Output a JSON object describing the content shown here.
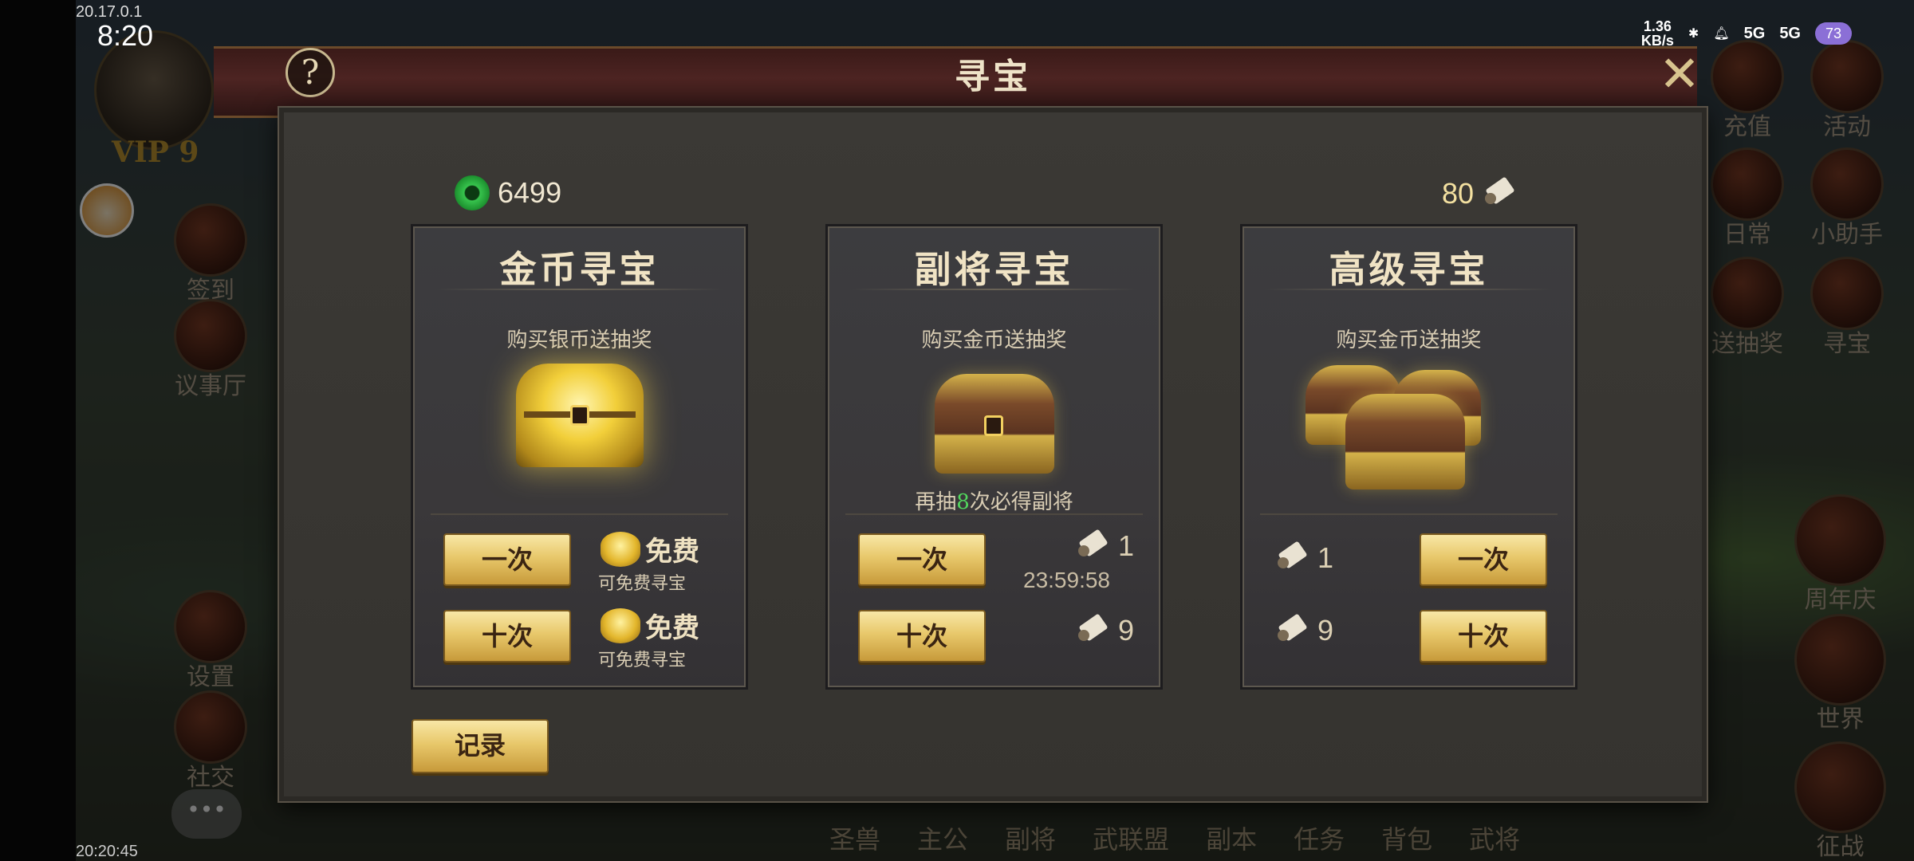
{
  "status_bar": {
    "version": "20.17.0.1",
    "time": "8:20",
    "net_speed_value": "1.36",
    "net_speed_unit": "KB/s",
    "signal_1": "5G",
    "signal_2": "5G",
    "battery": "73"
  },
  "bottom_clock": "20:20:45",
  "player": {
    "vip": "VIP 9"
  },
  "side_left": [
    "签到",
    "议事厅",
    "设置",
    "社交"
  ],
  "side_right_top": [
    "充值",
    "活动",
    "日常",
    "小助手",
    "送抽奖",
    "寻宝"
  ],
  "side_right_bottom": [
    "周年庆",
    "世界",
    "征战"
  ],
  "bottom_bar": [
    "圣兽",
    "主公",
    "副将",
    "武联盟",
    "副本",
    "任务",
    "背包",
    "武将"
  ],
  "modal": {
    "title": "寻宝",
    "help": "?",
    "jade_amount": "6499",
    "scroll_amount": "80",
    "record_label": "记录"
  },
  "cards": [
    {
      "title": "金币寻宝",
      "subtitle": "购买银币送抽奖",
      "once_label": "一次",
      "ten_label": "十次",
      "once_free": "免费",
      "once_free_sub": "可免费寻宝",
      "ten_free": "免费",
      "ten_free_sub": "可免费寻宝"
    },
    {
      "title": "副将寻宝",
      "subtitle": "购买金币送抽奖",
      "note_prefix": "再抽",
      "note_count": "8",
      "note_suffix": "次必得副将",
      "once_label": "一次",
      "ten_label": "十次",
      "once_cost": "1",
      "timer": "23:59:58",
      "ten_cost": "9"
    },
    {
      "title": "高级寻宝",
      "subtitle": "购买金币送抽奖",
      "once_label": "一次",
      "ten_label": "十次",
      "once_cost": "1",
      "ten_cost": "9"
    }
  ],
  "colors": {
    "accent_gold": "#e8c86b",
    "highlight_green": "#52d85e",
    "header_red": "#4d2422"
  }
}
